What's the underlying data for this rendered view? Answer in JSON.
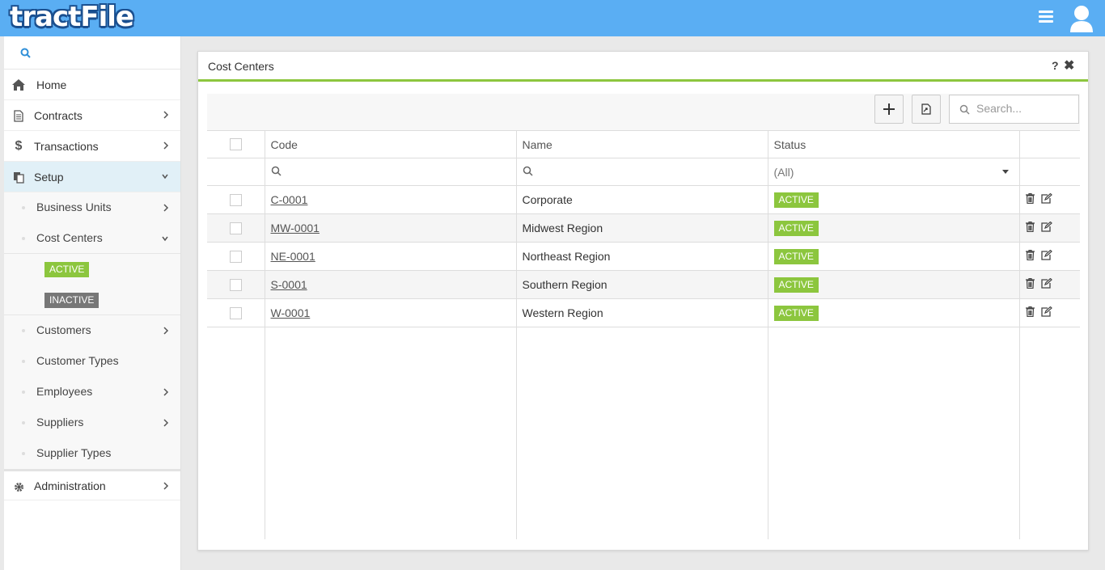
{
  "app": {
    "logo": "tractFile"
  },
  "sidebar": {
    "items": [
      {
        "label": "Home"
      },
      {
        "label": "Contracts"
      },
      {
        "label": "Transactions"
      },
      {
        "label": "Setup"
      }
    ],
    "setup_sub": [
      {
        "label": "Business Units"
      },
      {
        "label": "Cost Centers"
      }
    ],
    "cost_center_filters": {
      "active": "ACTIVE",
      "inactive": "INACTIVE"
    },
    "setup_sub2": [
      {
        "label": "Customers"
      },
      {
        "label": "Customer Types"
      },
      {
        "label": "Employees"
      },
      {
        "label": "Suppliers"
      },
      {
        "label": "Supplier Types"
      }
    ],
    "admin": {
      "label": "Administration"
    }
  },
  "panel": {
    "title": "Cost Centers",
    "help": "?",
    "close": "✖",
    "search_placeholder": "Search...",
    "columns": [
      "Code",
      "Name",
      "Status"
    ],
    "status_filter": "(All)",
    "rows": [
      {
        "code": "C-0001",
        "name": "Corporate",
        "status": "ACTIVE"
      },
      {
        "code": "MW-0001",
        "name": "Midwest Region",
        "status": "ACTIVE"
      },
      {
        "code": "NE-0001",
        "name": "Northeast Region",
        "status": "ACTIVE"
      },
      {
        "code": "S-0001",
        "name": "Southern Region",
        "status": "ACTIVE"
      },
      {
        "code": "W-0001",
        "name": "Western Region",
        "status": "ACTIVE"
      }
    ]
  },
  "colors": {
    "header": "#5aaef3",
    "accent_green": "#8cc63e",
    "active_menu": "#e1f0f7"
  }
}
